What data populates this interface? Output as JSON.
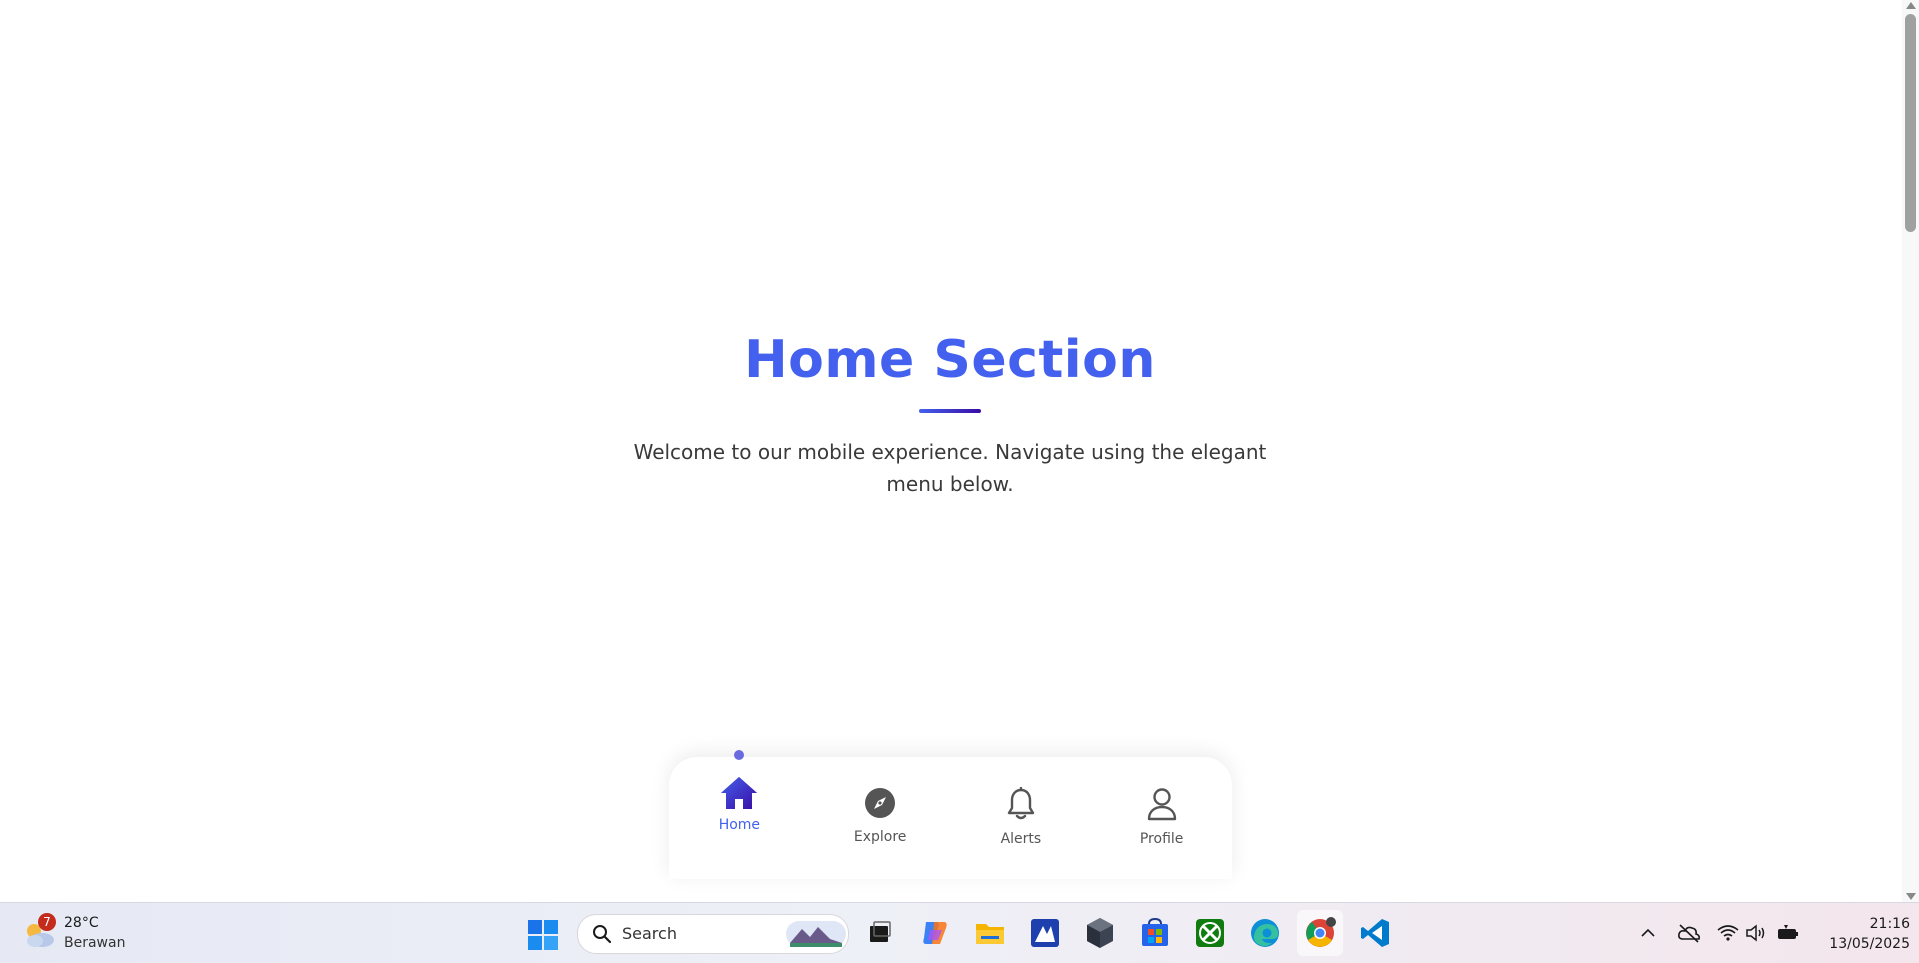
{
  "page": {
    "title": "Home Section",
    "description": "Welcome to our mobile experience. Navigate using the elegant menu below."
  },
  "nav": {
    "active": "home",
    "items": [
      {
        "id": "home",
        "label": "Home",
        "icon": "home-icon"
      },
      {
        "id": "explore",
        "label": "Explore",
        "icon": "compass-icon"
      },
      {
        "id": "alerts",
        "label": "Alerts",
        "icon": "bell-icon"
      },
      {
        "id": "profile",
        "label": "Profile",
        "icon": "user-icon"
      }
    ]
  },
  "colors": {
    "accent": "#4361ee",
    "accent_dark": "#3a0ca3",
    "dot": "#6a6ae0"
  },
  "taskbar": {
    "weather": {
      "badge": "7",
      "temp": "28°C",
      "desc": "Berawan",
      "icon": "cloud-sun-icon"
    },
    "search_label": "Search",
    "apps": [
      "task-view",
      "copilot",
      "file-explorer",
      "image-app",
      "settings-app",
      "microsoft-store",
      "xbox",
      "edge",
      "chrome",
      "vscode"
    ],
    "time": "21:16",
    "date": "13/05/2025"
  }
}
